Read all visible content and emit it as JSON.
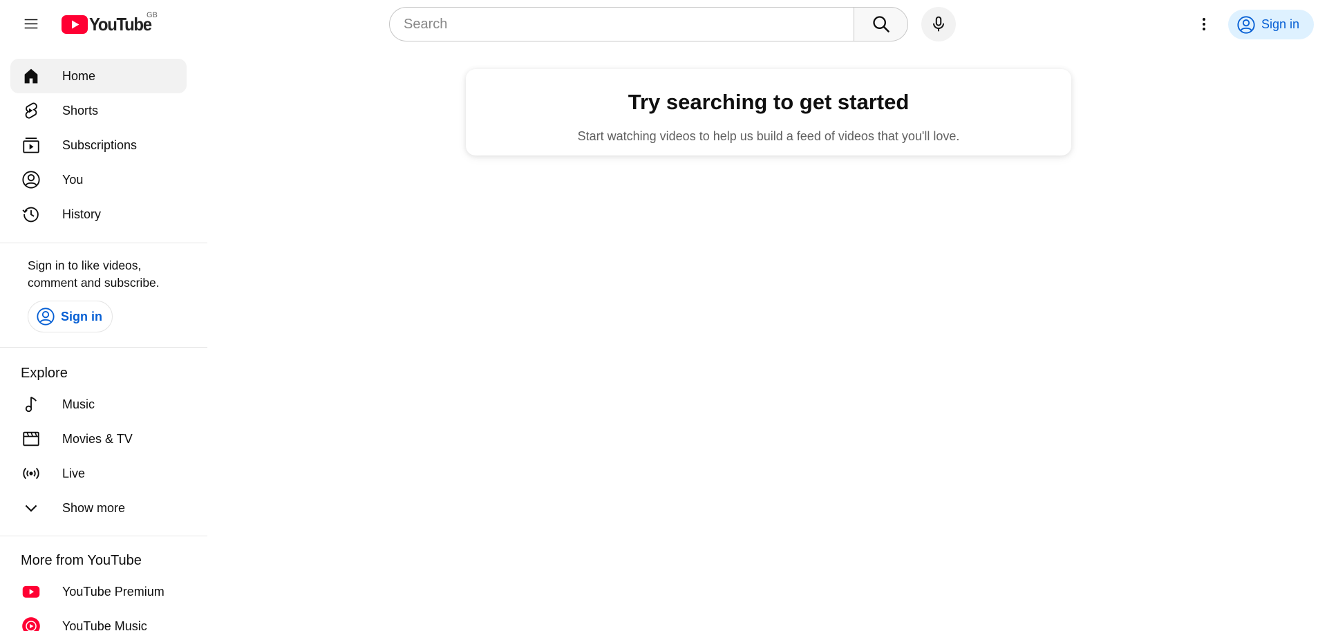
{
  "header": {
    "logo_text": "YouTube",
    "region": "GB",
    "search_placeholder": "Search",
    "sign_in_label": "Sign in"
  },
  "sidebar": {
    "primary": [
      {
        "label": "Home",
        "icon": "home-icon",
        "active": true
      },
      {
        "label": "Shorts",
        "icon": "shorts-icon"
      },
      {
        "label": "Subscriptions",
        "icon": "subscriptions-icon"
      },
      {
        "label": "You",
        "icon": "you-icon"
      },
      {
        "label": "History",
        "icon": "history-icon"
      }
    ],
    "signin_promo": "Sign in to like videos, comment and subscribe.",
    "signin_label": "Sign in",
    "explore_title": "Explore",
    "explore": [
      {
        "label": "Music",
        "icon": "music-icon"
      },
      {
        "label": "Movies & TV",
        "icon": "movies-icon"
      },
      {
        "label": "Live",
        "icon": "live-icon"
      },
      {
        "label": "Show more",
        "icon": "chevron-down-icon"
      }
    ],
    "more_title": "More from YouTube",
    "more": [
      {
        "label": "YouTube Premium",
        "icon": "youtube-premium-icon"
      },
      {
        "label": "YouTube Music",
        "icon": "youtube-music-icon"
      }
    ]
  },
  "main": {
    "empty_title": "Try searching to get started",
    "empty_subtitle": "Start watching videos to help us build a feed of videos that you'll love."
  },
  "colors": {
    "brand_red": "#ff0033",
    "link_blue": "#065fd4",
    "signin_bg": "#def1ff"
  }
}
